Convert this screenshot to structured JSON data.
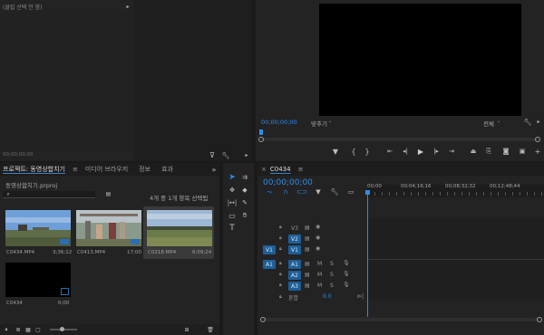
{
  "source_panel": {
    "title": "(클립 선택 안 함)",
    "timecode": "00;00;00;00"
  },
  "program_monitor": {
    "timecode": "00;00;00;00",
    "fit_label": "맞추기",
    "quality_label": "전체",
    "transport_icons": [
      "marker-icon",
      "mark-in-icon",
      "mark-out-icon",
      "go-to-in-icon",
      "step-back-icon",
      "play-icon",
      "step-forward-icon",
      "go-to-out-icon",
      "lift-icon",
      "extract-icon",
      "export-frame-icon",
      "comparison-icon"
    ]
  },
  "project_panel": {
    "tabs": [
      "프로젝트: 동영상합치기",
      "미디어 브라우저",
      "정보",
      "효과"
    ],
    "project_file": "동영상합치기.prproj",
    "selection_status": "4개 중 1개 항목 선택됨",
    "items": [
      {
        "name": "C0434.MP4",
        "duration": "3;36;12",
        "thumb": "field"
      },
      {
        "name": "C0413.MP4",
        "duration": "17;00",
        "thumb": "people"
      },
      {
        "name": "C0218.MP4",
        "duration": "6;09;24",
        "thumb": "grass",
        "selected": true
      },
      {
        "name": "C0434",
        "duration": "0;00",
        "thumb": "sequence"
      }
    ]
  },
  "tools": [
    "selection-tool-icon",
    "track-select-tool-icon",
    "ripple-edit-tool-icon",
    "razor-tool-icon",
    "slip-tool-icon",
    "pen-tool-icon",
    "rectangle-tool-icon",
    "hand-tool-icon",
    "type-tool-icon"
  ],
  "timeline": {
    "sequence_name": "C0434",
    "timecode": "00;00;00;00",
    "ruler_labels": [
      "00;00",
      "00;04;16;16",
      "00;08;32;32",
      "00;12;48;44"
    ],
    "video_tracks": [
      {
        "label": "V3",
        "source_patch": ""
      },
      {
        "label": "V2",
        "source_patch": ""
      },
      {
        "label": "V1",
        "source_patch": "V1"
      }
    ],
    "audio_tracks": [
      {
        "label": "A1",
        "source_patch": "A1",
        "m": "M",
        "s": "S"
      },
      {
        "label": "A2",
        "source_patch": "",
        "m": "M",
        "s": "S"
      },
      {
        "label": "A3",
        "source_patch": "",
        "m": "M",
        "s": "S"
      }
    ],
    "mix": {
      "label": "혼합",
      "value": "0.0"
    }
  },
  "colors": {
    "accent": "#2d8ceb",
    "patch": "#1e5f98",
    "panel": "#232323",
    "bg": "#1a1a1a"
  }
}
